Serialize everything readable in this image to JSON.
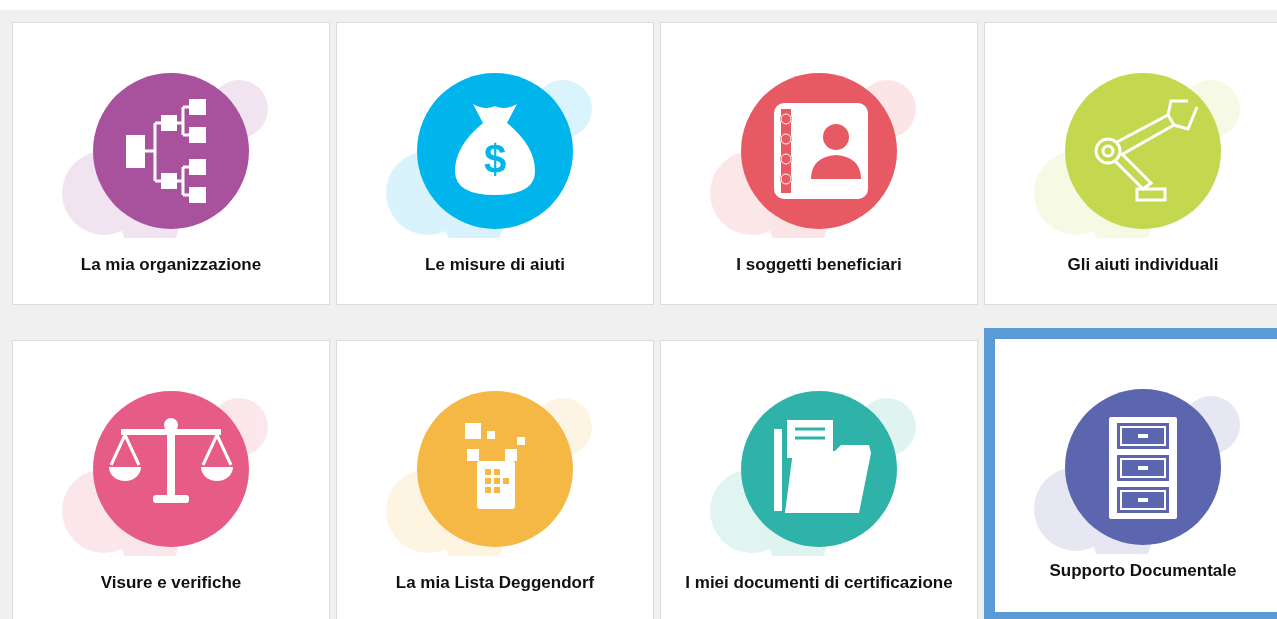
{
  "tiles": [
    {
      "label": "La mia organizzazione",
      "color": "#a8529e",
      "selected": false
    },
    {
      "label": "Le misure di aiuti",
      "color": "#00b5ec",
      "selected": false,
      "symbol": "$"
    },
    {
      "label": "I soggetti beneficiari",
      "color": "#e75a64",
      "selected": false
    },
    {
      "label": "Gli aiuti individuali",
      "color": "#c4d84f",
      "selected": false
    },
    {
      "label": "Visure e verifiche",
      "color": "#e75b87",
      "selected": false
    },
    {
      "label": "La mia Lista Deggendorf",
      "color": "#f6b844",
      "selected": false
    },
    {
      "label": "I miei documenti di certificazione",
      "color": "#2fb3a9",
      "selected": false
    },
    {
      "label": "Supporto Documentale",
      "color": "#5b66ae",
      "selected": true
    }
  ]
}
